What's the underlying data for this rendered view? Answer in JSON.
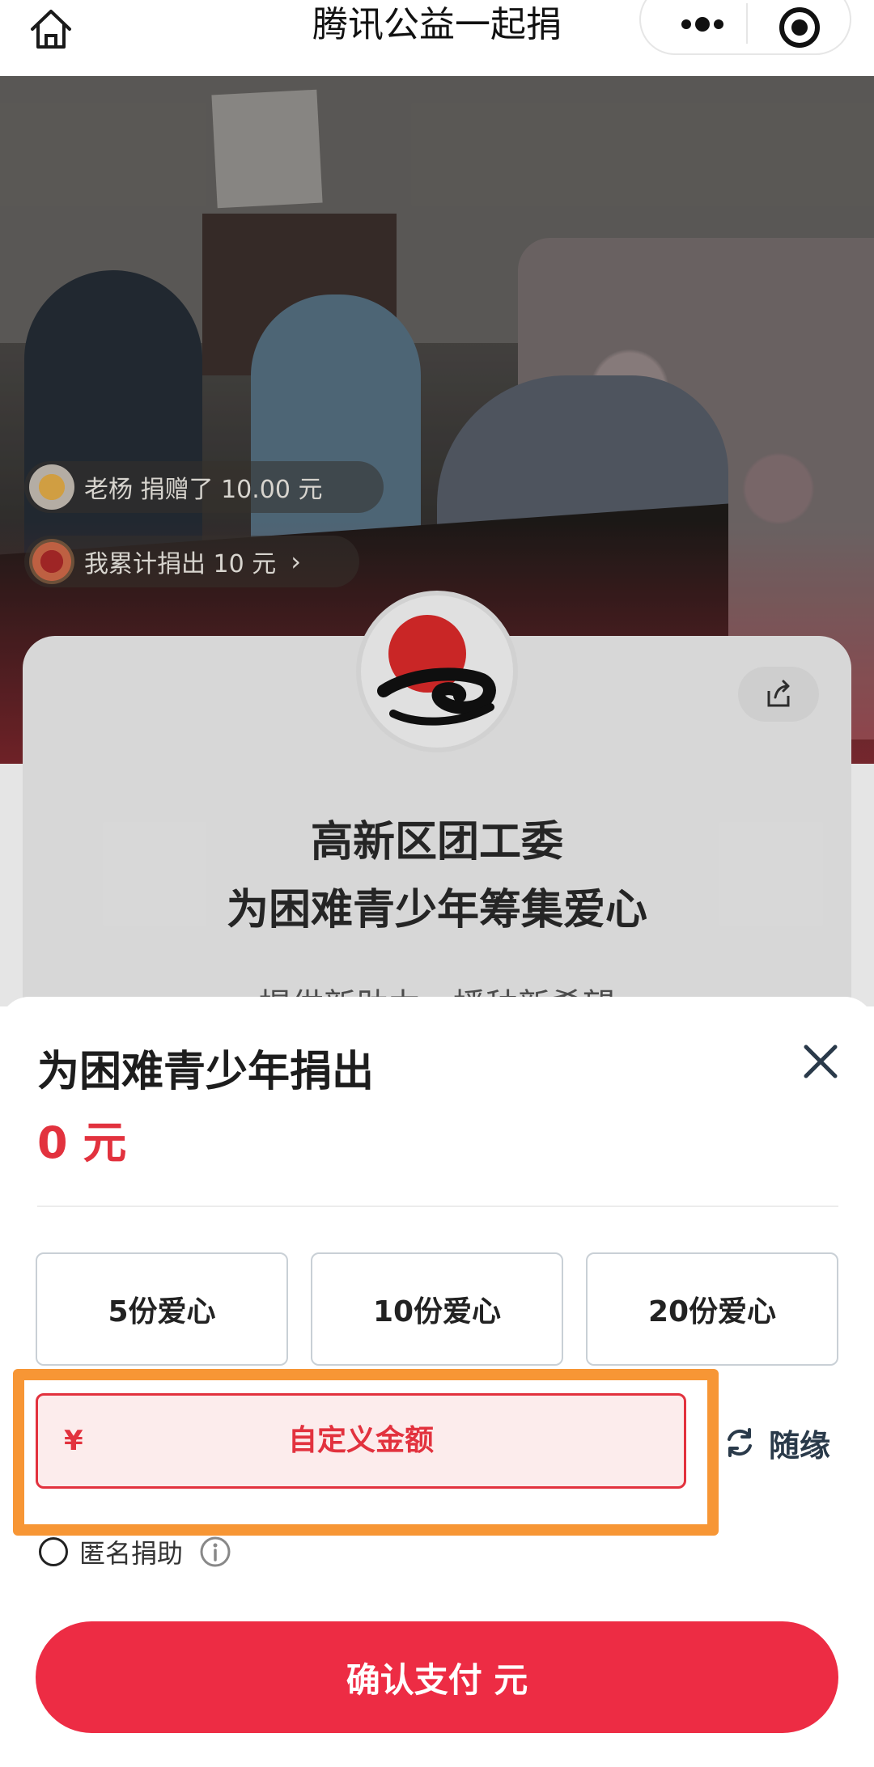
{
  "header": {
    "title": "腾讯公益一起捐",
    "home_icon": "home-icon",
    "more_icon": "more-dots-icon",
    "target_icon": "target-icon"
  },
  "hero": {
    "tickers": [
      {
        "text": "老杨 捐赠了 10.00 元"
      },
      {
        "text": "我累计捐出 10 元"
      }
    ]
  },
  "project": {
    "org_line1": "高新区团工委",
    "org_line2": "为困难青少年筹集爱心",
    "slogan": "提供新助力，播种新希望",
    "share_icon": "share-icon"
  },
  "sheet": {
    "title": "为困难青少年捐出",
    "amount": "0 元",
    "options": [
      "5份爱心",
      "10份爱心",
      "20份爱心"
    ],
    "custom": {
      "currency": "¥",
      "placeholder": "自定义金额"
    },
    "random_label": "随缘",
    "anonymous_label": "匿名捐助",
    "pay_label": "确认支付 元",
    "colors": {
      "accent": "#e2323e",
      "pay_button": "#ed2c44",
      "highlight": "#f79635"
    }
  }
}
